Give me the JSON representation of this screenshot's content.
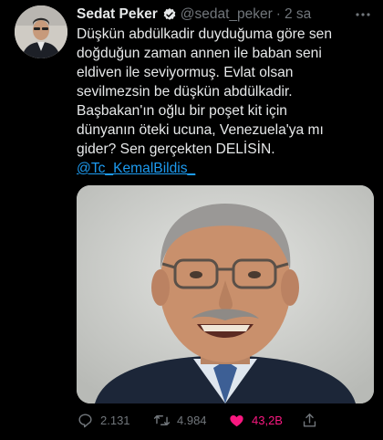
{
  "tweet": {
    "author_name": "Sedat Peker",
    "handle": "@sedat_peker",
    "separator": "·",
    "time": "2 sa",
    "text_lines": [
      "Düşkün abdülkadir duyduğuma göre sen",
      "doğduğun zaman annen ile baban seni",
      "eldiven ile seviyormuş. Evlat olsan",
      "sevilmezsin be düşkün abdülkadir.",
      "Başbakan'ın oğlu bir poşet kit için",
      "dünyanın öteki ucuna,  Venezuela'ya mı",
      "gider? Sen gerçekten DELİSİN."
    ],
    "mention": "@Tc_KemalBildis_"
  },
  "actions": {
    "reply_count": "2.131",
    "retweet_count": "4.984",
    "like_count": "43,2B"
  },
  "colors": {
    "background": "#000000",
    "text": "#e7e9ea",
    "muted": "#71767b",
    "link": "#1d9bf0",
    "like": "#f91880"
  },
  "icons": [
    "verified-badge-icon",
    "more-icon",
    "reply-icon",
    "retweet-icon",
    "like-icon",
    "share-icon"
  ]
}
